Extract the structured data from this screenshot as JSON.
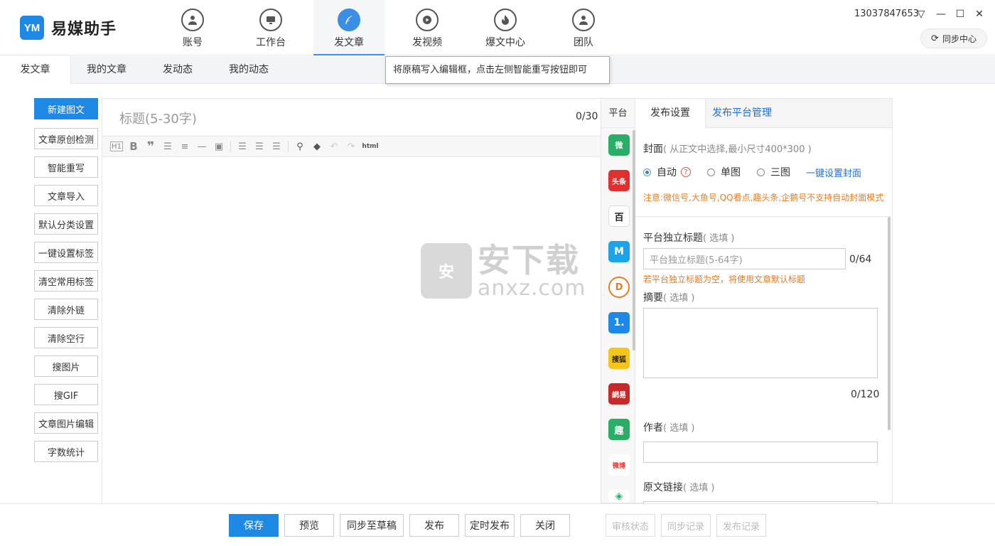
{
  "app": {
    "name": "易媒助手",
    "logo_mark": "YM",
    "account": "13037847653",
    "sync_center": "同步中心"
  },
  "nav": [
    {
      "label": "账号",
      "icon": "user-icon"
    },
    {
      "label": "工作台",
      "icon": "monitor-icon"
    },
    {
      "label": "发文章",
      "icon": "feather-icon"
    },
    {
      "label": "发视频",
      "icon": "play-icon"
    },
    {
      "label": "爆文中心",
      "icon": "fire-icon"
    },
    {
      "label": "团队",
      "icon": "team-icon"
    }
  ],
  "subtabs": [
    "发文章",
    "我的文章",
    "发动态",
    "我的动态"
  ],
  "tooltip": "将原稿写入编辑框，点击左侧智能重写按钮即可",
  "left_buttons": [
    "新建图文",
    "文章原创检测",
    "智能重写",
    "文章导入",
    "默认分类设置",
    "一键设置标签",
    "清空常用标签",
    "清除外链",
    "清除空行",
    "搜图片",
    "搜GIF",
    "文章图片编辑",
    "字数统计"
  ],
  "editor": {
    "title_placeholder": "标题(5-30字)",
    "title_count": "0/30",
    "toolbar_html": "html"
  },
  "watermark": {
    "cn": "安下载",
    "en": "anxz.com",
    "bag_char": "安"
  },
  "platforms": {
    "header": "平台",
    "items": [
      {
        "name": "wechat",
        "glyph": "微",
        "color": "#2aae67"
      },
      {
        "name": "toutiao",
        "glyph": "头条",
        "color": "#e02f2f"
      },
      {
        "name": "baijiahao",
        "glyph": "百",
        "color": "#ffffff"
      },
      {
        "name": "yidian",
        "glyph": "M",
        "color": "#1ba3e8"
      },
      {
        "name": "dayu",
        "glyph": "D",
        "color": "#ffffff"
      },
      {
        "name": "yidianzixun",
        "glyph": "1.",
        "color": "#1e88e5"
      },
      {
        "name": "sohu",
        "glyph": "搜狐",
        "color": "#f5c518"
      },
      {
        "name": "netease",
        "glyph": "網易",
        "color": "#c62b2b"
      },
      {
        "name": "qutoutiao",
        "glyph": "趣",
        "color": "#2aae67"
      },
      {
        "name": "weibo",
        "glyph": "微博",
        "color": "#ffffff"
      },
      {
        "name": "other",
        "glyph": "◈",
        "color": "#ffffff"
      }
    ]
  },
  "settings": {
    "tab_publish": "发布设置",
    "tab_platform_manage": "发布平台管理",
    "cover_label": "封面",
    "cover_hint": "( 从正文中选择,最小尺寸400*300 )",
    "cover_options": [
      "自动",
      "单图",
      "三图"
    ],
    "cover_selected": "自动",
    "one_click_cover": "一键设置封面",
    "cover_notice": "注意:微信号,大鱼号,QQ看点,趣头条,企鹅号不支持自动封面模式",
    "platform_title_label": "平台独立标题",
    "optional": "( 选填 )",
    "platform_title_placeholder": "平台独立标题(5-64字)",
    "platform_title_count": "0/64",
    "platform_title_hint": "若平台独立标题为空，将使用文章默认标题",
    "summary_label": "摘要",
    "summary_count": "0/120",
    "author_label": "作者",
    "source_link_label": "原文链接"
  },
  "bottom_buttons": [
    "保存",
    "预览",
    "同步至草稿",
    "发布",
    "定时发布",
    "关闭"
  ],
  "bottom_disabled": [
    "审核状态",
    "同步记录",
    "发布记录"
  ]
}
